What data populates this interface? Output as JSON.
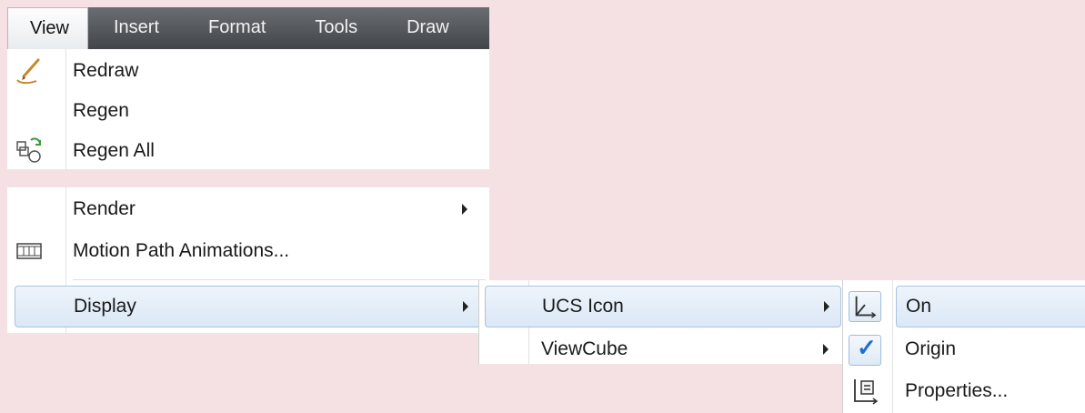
{
  "menubar": {
    "items": [
      {
        "label": "View"
      },
      {
        "label": "Insert"
      },
      {
        "label": "Format"
      },
      {
        "label": "Tools"
      },
      {
        "label": "Draw"
      }
    ]
  },
  "view_menu": {
    "items": [
      {
        "label": "Redraw",
        "icon": "redraw-icon"
      },
      {
        "label": "Regen"
      },
      {
        "label": "Regen All",
        "icon": "regen-all-icon"
      },
      {
        "label": "Render",
        "submenu": true
      },
      {
        "label": "Motion Path Animations...",
        "icon": "film-strip-icon"
      },
      {
        "label": "Display",
        "submenu": true,
        "highlighted": true
      }
    ]
  },
  "display_submenu": {
    "items": [
      {
        "label": "UCS Icon",
        "submenu": true,
        "highlighted": true
      },
      {
        "label": "ViewCube",
        "submenu": true
      }
    ]
  },
  "ucs_icon_submenu": {
    "items": [
      {
        "label": "On",
        "icon": "ucs-axis-icon",
        "checked": true
      },
      {
        "label": "Origin",
        "icon": "checkmark-icon",
        "checked": true
      },
      {
        "label": "Properties...",
        "icon": "ucs-properties-icon"
      }
    ]
  },
  "colors": {
    "background": "#f5e1e4",
    "menubar": "#4f5358",
    "highlight": "#dbe8f6",
    "check": "#1f6fd1"
  }
}
